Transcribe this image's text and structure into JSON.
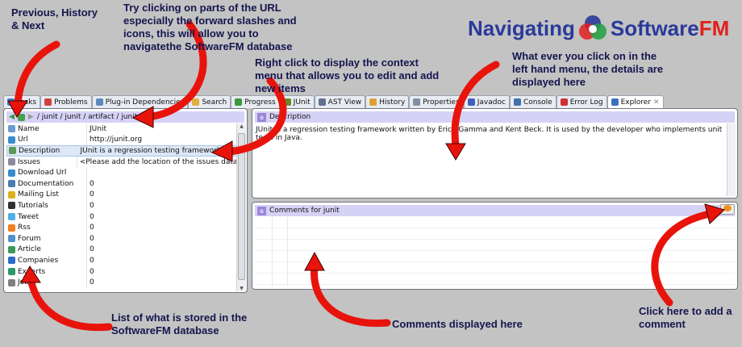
{
  "logo": {
    "text_a": "Navigating",
    "text_b": "Software",
    "text_c": "FM"
  },
  "annotations": {
    "nav": "Previous, History & Next",
    "url": "Try clicking on parts of the URL especially the forward slashes and icons, this will allow you to navigatethe SoftwareFM database",
    "context": "Right click to display the context menu that allows you to edit and add new items",
    "details": "What ever you click on in the left hand menu, the details are displayed here",
    "list": "List of what is stored in the SoftwareFM database",
    "comments": "Comments displayed here",
    "add": "Click here to add a comment"
  },
  "tabs": [
    {
      "label": "Tasks",
      "color": "#3a7bd5"
    },
    {
      "label": "Problems",
      "color": "#d04040"
    },
    {
      "label": "Plug-in Dependencies",
      "color": "#5a8ac0"
    },
    {
      "label": "Search",
      "color": "#e0b040"
    },
    {
      "label": "Progress",
      "color": "#3a9a3a"
    },
    {
      "label": "JUnit",
      "color": "#6a8a2a"
    },
    {
      "label": "AST View",
      "color": "#607090"
    },
    {
      "label": "History",
      "color": "#e0a030"
    },
    {
      "label": "Properties",
      "color": "#8090a0"
    },
    {
      "label": "Javadoc",
      "color": "#4060c0"
    },
    {
      "label": "Console",
      "color": "#4070b0"
    },
    {
      "label": "Error Log",
      "color": "#d03030"
    },
    {
      "label": "Explorer",
      "color": "#3a6fc0"
    }
  ],
  "explorer": {
    "breadcrumb": "/ junit / junit / artifact / junit /",
    "rows": [
      {
        "name": "Name",
        "value": "JUnit",
        "icon": "name-icon",
        "color": "#6a9ad0"
      },
      {
        "name": "Url",
        "value": "http://junit.org",
        "icon": "globe-icon",
        "color": "#3a8ad0"
      },
      {
        "name": "Description",
        "value": "JUnit is a regression testing framework written by",
        "icon": "description-icon",
        "color": "#5a9a5a"
      },
      {
        "name": "Issues",
        "value": "<Please add the location of the issues database>",
        "icon": "bug-icon",
        "color": "#8a8aa0"
      },
      {
        "name": "Download Url",
        "value": "",
        "icon": "globe-icon",
        "color": "#3a8ad0"
      },
      {
        "name": "Documentation",
        "value": "0",
        "icon": "documentation-icon",
        "color": "#4a7ab0"
      },
      {
        "name": "Mailing List",
        "value": "0",
        "icon": "mail-icon",
        "color": "#e0b020"
      },
      {
        "name": "Tutorials",
        "value": "0",
        "icon": "mortarboard-icon",
        "color": "#303030"
      },
      {
        "name": "Tweet",
        "value": "0",
        "icon": "twitter-icon",
        "color": "#50b0e8"
      },
      {
        "name": "Rss",
        "value": "0",
        "icon": "rss-icon",
        "color": "#f08020"
      },
      {
        "name": "Forum",
        "value": "0",
        "icon": "forum-icon",
        "color": "#5090d0"
      },
      {
        "name": "Article",
        "value": "0",
        "icon": "article-icon",
        "color": "#3a9a5a"
      },
      {
        "name": "Companies",
        "value": "0",
        "icon": "companies-icon",
        "color": "#2a6ad0"
      },
      {
        "name": "Experts",
        "value": "0",
        "icon": "experts-icon",
        "color": "#2a9a6a"
      },
      {
        "name": "Jobs",
        "value": "0",
        "icon": "jobs-icon",
        "color": "#808080"
      }
    ]
  },
  "description": {
    "title": "Description",
    "text": "JUnit is a regression testing framework written by Erich Gamma and Kent Beck. It is used by the developer who implements unit tests in Java."
  },
  "comments": {
    "title": "Comments for junit"
  },
  "colors": {
    "arrow": "#e8140c",
    "annotation": "#15154f",
    "header": "#d6d2f6"
  }
}
